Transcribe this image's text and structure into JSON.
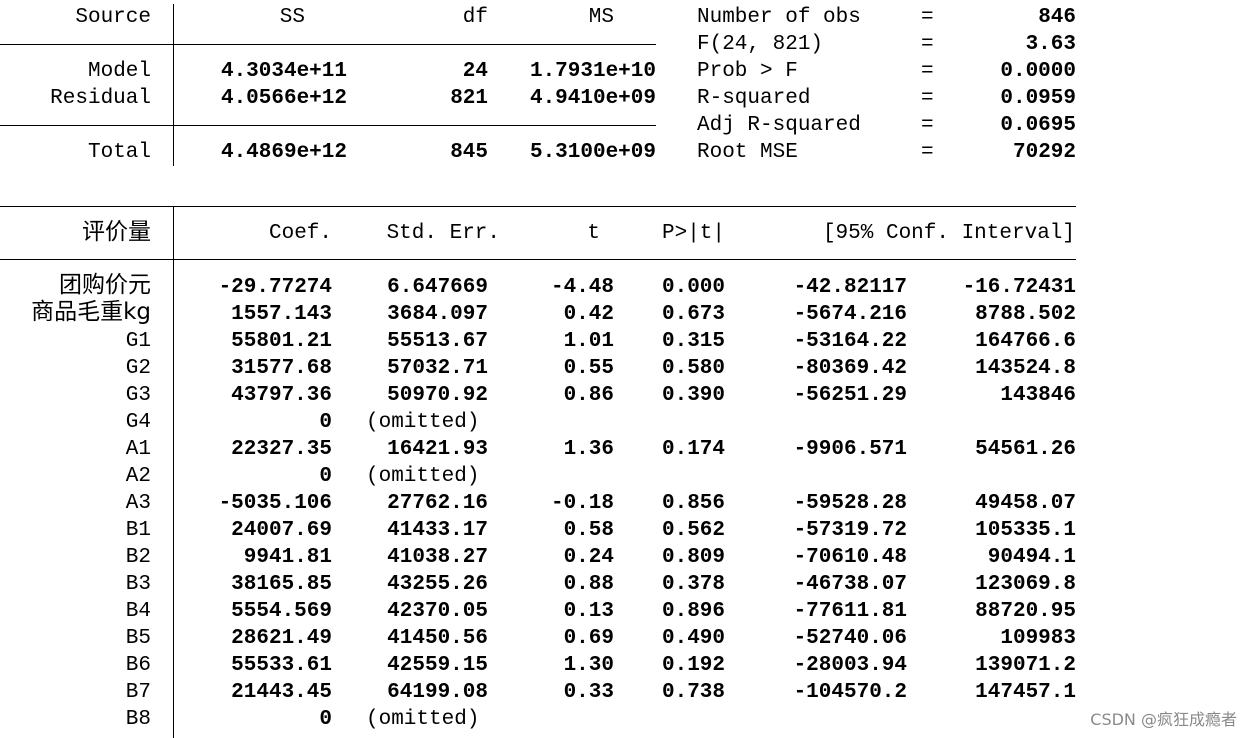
{
  "anova": {
    "headers": [
      "Source",
      "SS",
      "df",
      "MS"
    ],
    "rows": [
      {
        "source": "Model",
        "ss": "4.3034e+11",
        "df": "24",
        "ms": "1.7931e+10"
      },
      {
        "source": "Residual",
        "ss": "4.0566e+12",
        "df": "821",
        "ms": "4.9410e+09"
      },
      {
        "source": "Total",
        "ss": "4.4869e+12",
        "df": "845",
        "ms": "5.3100e+09"
      }
    ]
  },
  "stats": [
    {
      "label": "Number of obs",
      "eq": "=",
      "value": "846"
    },
    {
      "label": "F(24, 821)",
      "eq": "=",
      "value": "3.63"
    },
    {
      "label": "Prob > F",
      "eq": "=",
      "value": "0.0000"
    },
    {
      "label": "R-squared",
      "eq": "=",
      "value": "0.0959"
    },
    {
      "label": "Adj R-squared",
      "eq": "=",
      "value": "0.0695"
    },
    {
      "label": "Root MSE",
      "eq": "=",
      "value": "70292"
    }
  ],
  "coef_table": {
    "dep_var": "评价量",
    "headers": {
      "coef": "Coef.",
      "se": "Std. Err.",
      "t": "t",
      "p": "P>|t|",
      "ci": "[95% Conf. Interval]"
    },
    "rows": [
      {
        "name": "团购价元",
        "coef": "-29.77274",
        "se": "6.647669",
        "t": "-4.48",
        "p": "0.000",
        "lo": "-42.82117",
        "hi": "-16.72431"
      },
      {
        "name": "商品毛重kg",
        "coef": "1557.143",
        "se": "3684.097",
        "t": "0.42",
        "p": "0.673",
        "lo": "-5674.216",
        "hi": "8788.502"
      },
      {
        "name": "G1",
        "coef": "55801.21",
        "se": "55513.67",
        "t": "1.01",
        "p": "0.315",
        "lo": "-53164.22",
        "hi": "164766.6"
      },
      {
        "name": "G2",
        "coef": "31577.68",
        "se": "57032.71",
        "t": "0.55",
        "p": "0.580",
        "lo": "-80369.42",
        "hi": "143524.8"
      },
      {
        "name": "G3",
        "coef": "43797.36",
        "se": "50970.92",
        "t": "0.86",
        "p": "0.390",
        "lo": "-56251.29",
        "hi": "143846"
      },
      {
        "name": "G4",
        "coef": "0",
        "se": "(omitted)",
        "t": "",
        "p": "",
        "lo": "",
        "hi": ""
      },
      {
        "name": "A1",
        "coef": "22327.35",
        "se": "16421.93",
        "t": "1.36",
        "p": "0.174",
        "lo": "-9906.571",
        "hi": "54561.26"
      },
      {
        "name": "A2",
        "coef": "0",
        "se": "(omitted)",
        "t": "",
        "p": "",
        "lo": "",
        "hi": ""
      },
      {
        "name": "A3",
        "coef": "-5035.106",
        "se": "27762.16",
        "t": "-0.18",
        "p": "0.856",
        "lo": "-59528.28",
        "hi": "49458.07"
      },
      {
        "name": "B1",
        "coef": "24007.69",
        "se": "41433.17",
        "t": "0.58",
        "p": "0.562",
        "lo": "-57319.72",
        "hi": "105335.1"
      },
      {
        "name": "B2",
        "coef": "9941.81",
        "se": "41038.27",
        "t": "0.24",
        "p": "0.809",
        "lo": "-70610.48",
        "hi": "90494.1"
      },
      {
        "name": "B3",
        "coef": "38165.85",
        "se": "43255.26",
        "t": "0.88",
        "p": "0.378",
        "lo": "-46738.07",
        "hi": "123069.8"
      },
      {
        "name": "B4",
        "coef": "5554.569",
        "se": "42370.05",
        "t": "0.13",
        "p": "0.896",
        "lo": "-77611.81",
        "hi": "88720.95"
      },
      {
        "name": "B5",
        "coef": "28621.49",
        "se": "41450.56",
        "t": "0.69",
        "p": "0.490",
        "lo": "-52740.06",
        "hi": "109983"
      },
      {
        "name": "B6",
        "coef": "55533.61",
        "se": "42559.15",
        "t": "1.30",
        "p": "0.192",
        "lo": "-28003.94",
        "hi": "139071.2"
      },
      {
        "name": "B7",
        "coef": "21443.45",
        "se": "64199.08",
        "t": "0.33",
        "p": "0.738",
        "lo": "-104570.2",
        "hi": "147457.1"
      },
      {
        "name": "B8",
        "coef": "0",
        "se": "(omitted)",
        "t": "",
        "p": "",
        "lo": "",
        "hi": ""
      }
    ]
  },
  "watermark": "CSDN @疯狂成瘾者"
}
